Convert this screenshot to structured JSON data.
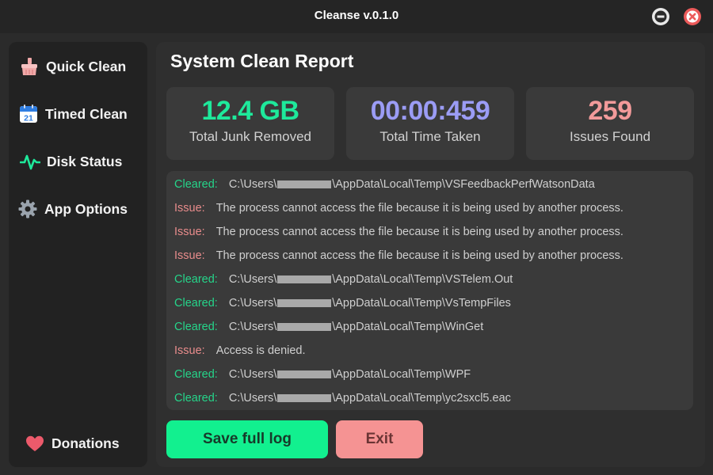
{
  "window": {
    "title": "Cleanse v.0.1.0"
  },
  "sidebar": {
    "items": [
      {
        "label": "Quick Clean",
        "icon": "broom-icon"
      },
      {
        "label": "Timed Clean",
        "icon": "calendar-icon"
      },
      {
        "label": "Disk Status",
        "icon": "pulse-icon"
      },
      {
        "label": "App Options",
        "icon": "gear-icon"
      }
    ],
    "calendar_day": "21",
    "donations": {
      "label": "Donations",
      "icon": "heart-icon"
    }
  },
  "report": {
    "title": "System Clean Report",
    "stats": [
      {
        "value": "12.4 GB",
        "caption": "Total Junk Removed",
        "color": "#1ee99b"
      },
      {
        "value": "00:00:459",
        "caption": "Total Time Taken",
        "color": "#9b9cf5"
      },
      {
        "value": "259",
        "caption": "Issues Found",
        "color": "#f29a9a"
      }
    ]
  },
  "colors": {
    "cleared": "#25d58a",
    "issue": "#e98c8c",
    "accent_green": "#12f08f",
    "accent_red": "#f59393"
  },
  "log": {
    "entries": [
      {
        "tag": "Cleared:",
        "type": "cleared",
        "prefix": "C:\\Users\\",
        "suffix": "\\AppData\\Local\\Temp\\VSFeedbackPerfWatsonData"
      },
      {
        "tag": "Issue:",
        "type": "issue",
        "text": "The process cannot access the file because it is being used by another process."
      },
      {
        "tag": "Issue:",
        "type": "issue",
        "text": "The process cannot access the file because it is being used by another process."
      },
      {
        "tag": "Issue:",
        "type": "issue",
        "text": "The process cannot access the file because it is being used by another process."
      },
      {
        "tag": "Cleared:",
        "type": "cleared",
        "prefix": "C:\\Users\\",
        "suffix": "\\AppData\\Local\\Temp\\VSTelem.Out"
      },
      {
        "tag": "Cleared:",
        "type": "cleared",
        "prefix": "C:\\Users\\",
        "suffix": "\\AppData\\Local\\Temp\\VsTempFiles"
      },
      {
        "tag": "Cleared:",
        "type": "cleared",
        "prefix": "C:\\Users\\",
        "suffix": "\\AppData\\Local\\Temp\\WinGet"
      },
      {
        "tag": "Issue:",
        "type": "issue",
        "text": "Access is denied."
      },
      {
        "tag": "Cleared:",
        "type": "cleared",
        "prefix": "C:\\Users\\",
        "suffix": "\\AppData\\Local\\Temp\\WPF"
      },
      {
        "tag": "Cleared:",
        "type": "cleared",
        "prefix": "C:\\Users\\",
        "suffix": "\\AppData\\Local\\Temp\\yc2sxcl5.eac"
      }
    ]
  },
  "actions": {
    "save_label": "Save full log",
    "exit_label": "Exit"
  }
}
